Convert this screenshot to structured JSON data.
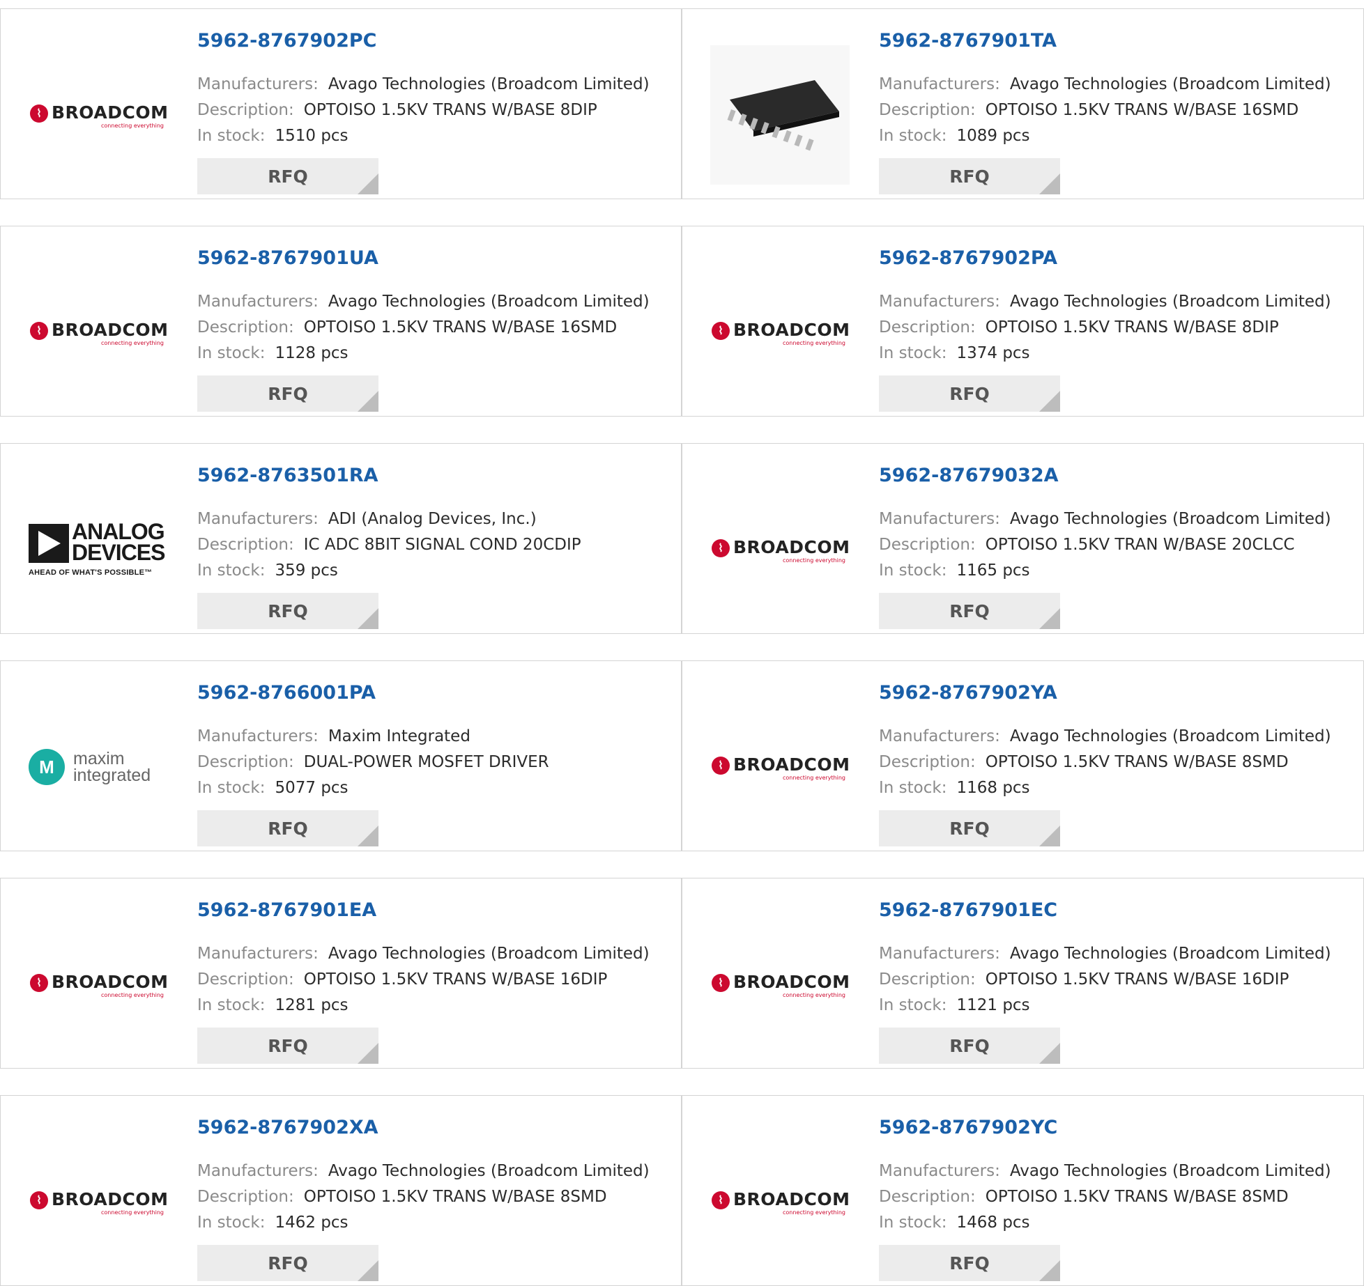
{
  "labels": {
    "manufacturers": "Manufacturers:",
    "description": "Description:",
    "in_stock": "In stock:",
    "rfq": "RFQ"
  },
  "logos": {
    "broadcom": {
      "word": "BROADCOM",
      "tagline": "connecting everything"
    },
    "adi": {
      "line1": "ANALOG",
      "line2": "DEVICES",
      "tagline": "AHEAD OF WHAT'S POSSIBLE™"
    },
    "maxim": {
      "line1": "maxim",
      "line2": "integrated"
    }
  },
  "colors": {
    "part_link": "#1a5fa8",
    "label": "#8a8a8a",
    "rfq_bg": "#ececec",
    "broadcom_red": "#cc092f",
    "maxim_teal": "#1aaea3"
  },
  "products": [
    {
      "part": "5962-8767902PC",
      "logo": "broadcom",
      "manufacturer": "Avago Technologies (Broadcom Limited)",
      "description": "OPTOISO 1.5KV TRANS W/BASE 8DIP",
      "stock": "1510 pcs"
    },
    {
      "part": "5962-8767901TA",
      "logo": "chip-photo",
      "manufacturer": "Avago Technologies (Broadcom Limited)",
      "description": "OPTOISO 1.5KV TRANS W/BASE 16SMD",
      "stock": "1089 pcs"
    },
    {
      "part": "5962-8767901UA",
      "logo": "broadcom",
      "manufacturer": "Avago Technologies (Broadcom Limited)",
      "description": "OPTOISO 1.5KV TRANS W/BASE 16SMD",
      "stock": "1128 pcs"
    },
    {
      "part": "5962-8767902PA",
      "logo": "broadcom",
      "manufacturer": "Avago Technologies (Broadcom Limited)",
      "description": "OPTOISO 1.5KV TRANS W/BASE 8DIP",
      "stock": "1374 pcs"
    },
    {
      "part": "5962-8763501RA",
      "logo": "adi",
      "manufacturer": "ADI (Analog Devices, Inc.)",
      "description": "IC ADC 8BIT SIGNAL COND 20CDIP",
      "stock": "359 pcs"
    },
    {
      "part": "5962-87679032A",
      "logo": "broadcom",
      "manufacturer": "Avago Technologies (Broadcom Limited)",
      "description": "OPTOISO 1.5KV TRAN W/BASE 20CLCC",
      "stock": "1165 pcs"
    },
    {
      "part": "5962-8766001PA",
      "logo": "maxim",
      "manufacturer": "Maxim Integrated",
      "description": "DUAL-POWER MOSFET DRIVER",
      "stock": "5077 pcs"
    },
    {
      "part": "5962-8767902YA",
      "logo": "broadcom",
      "manufacturer": "Avago Technologies (Broadcom Limited)",
      "description": "OPTOISO 1.5KV TRANS W/BASE 8SMD",
      "stock": "1168 pcs"
    },
    {
      "part": "5962-8767901EA",
      "logo": "broadcom",
      "manufacturer": "Avago Technologies (Broadcom Limited)",
      "description": "OPTOISO 1.5KV TRANS W/BASE 16DIP",
      "stock": "1281 pcs"
    },
    {
      "part": "5962-8767901EC",
      "logo": "broadcom",
      "manufacturer": "Avago Technologies (Broadcom Limited)",
      "description": "OPTOISO 1.5KV TRANS W/BASE 16DIP",
      "stock": "1121 pcs"
    },
    {
      "part": "5962-8767902XA",
      "logo": "broadcom",
      "manufacturer": "Avago Technologies (Broadcom Limited)",
      "description": "OPTOISO 1.5KV TRANS W/BASE 8SMD",
      "stock": "1462 pcs"
    },
    {
      "part": "5962-8767902YC",
      "logo": "broadcom",
      "manufacturer": "Avago Technologies (Broadcom Limited)",
      "description": "OPTOISO 1.5KV TRANS W/BASE 8SMD",
      "stock": "1468 pcs"
    }
  ]
}
